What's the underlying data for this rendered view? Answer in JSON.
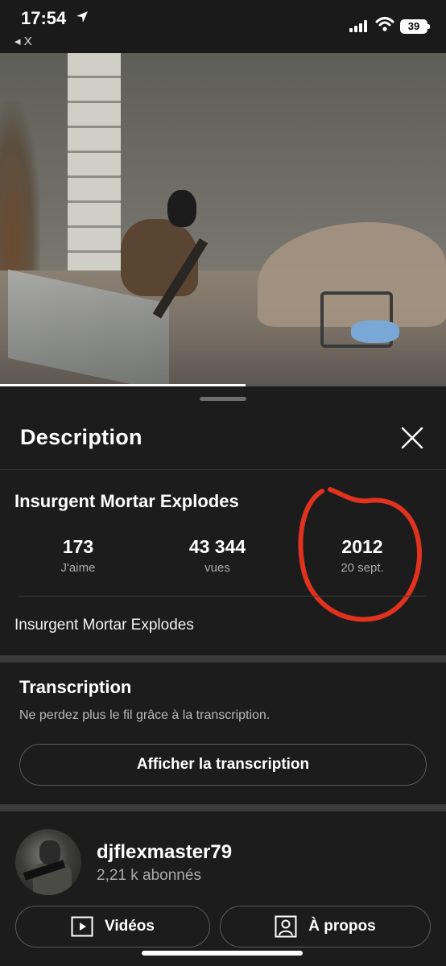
{
  "status_bar": {
    "time": "17:54",
    "back_label": "◂ X",
    "battery": "39"
  },
  "video": {
    "progress": 0.55
  },
  "description_panel": {
    "title": "Description",
    "video_title": "Insurgent Mortar Explodes",
    "stats": [
      {
        "value": "173",
        "label": "J'aime"
      },
      {
        "value": "43 344",
        "label": "vues"
      },
      {
        "value": "2012",
        "label": "20 sept."
      }
    ],
    "description_text": "Insurgent Mortar Explodes",
    "annotation_color": "#e0321f"
  },
  "transcription": {
    "title": "Transcription",
    "subtitle": "Ne perdez plus le fil grâce à la transcription.",
    "button_label": "Afficher la transcription"
  },
  "channel": {
    "name": "djflexmaster79",
    "subscribers": "2,21 k abonnés",
    "videos_button": "Vidéos",
    "about_button": "À propos"
  }
}
